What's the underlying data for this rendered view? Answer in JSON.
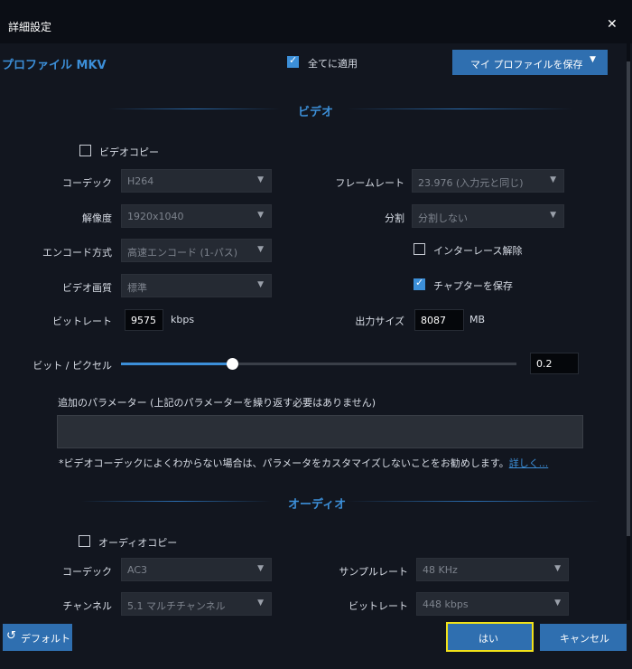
{
  "window": {
    "title": "詳細設定",
    "close_icon": "✕"
  },
  "profile": {
    "name": "プロファイル MKV"
  },
  "apply_all": {
    "label": "全てに適用",
    "checked": true
  },
  "save_profile": {
    "label": "マイ プロファイルを保存"
  },
  "video": {
    "section_title": "ビデオ",
    "copy": {
      "label": "ビデオコピー",
      "checked": false
    },
    "codec": {
      "label": "コーデック",
      "value": "H264"
    },
    "resolution": {
      "label": "解像度",
      "value": "1920x1040"
    },
    "encode_mode": {
      "label": "エンコード方式",
      "value": "高速エンコード (1-パス)"
    },
    "quality": {
      "label": "ビデオ画質",
      "value": "標準"
    },
    "bitrate": {
      "label": "ビットレート",
      "value": "9575",
      "unit": "kbps"
    },
    "framerate": {
      "label": "フレームレート",
      "value": "23.976 (入力元と同じ)"
    },
    "split": {
      "label": "分割",
      "value": "分割しない"
    },
    "deinterlace": {
      "label": "インターレース解除",
      "checked": false
    },
    "keep_chapters": {
      "label": "チャプターを保存",
      "checked": true
    },
    "output_size": {
      "label": "出力サイズ",
      "value": "8087",
      "unit": "MB"
    },
    "bits_per_pixel": {
      "label": "ビット / ピクセル",
      "value": "0.2",
      "slider_fraction": 0.28
    },
    "extra_params": {
      "label": "追加のパラメーター (上記のパラメーターを繰り返す必要はありません)",
      "value": ""
    },
    "note": {
      "text": "*ビデオコーデックによくわからない場合は、パラメータをカスタマイズしないことをお勧めします。",
      "link": "詳しく..."
    }
  },
  "audio": {
    "section_title": "オーディオ",
    "copy": {
      "label": "オーディオコピー",
      "checked": false
    },
    "codec": {
      "label": "コーデック",
      "value": "AC3"
    },
    "channels": {
      "label": "チャンネル",
      "value": "5.1 マルチチャンネル"
    },
    "sample_rate": {
      "label": "サンプルレート",
      "value": "48 KHz"
    },
    "bitrate": {
      "label": "ビットレート",
      "value": "448 kbps"
    }
  },
  "footer": {
    "default_label": "デフォルト",
    "ok_label": "はい",
    "cancel_label": "キャンセル"
  },
  "colors": {
    "accent": "#3c8fd8",
    "button": "#2f6fb0",
    "focus": "#f2e21a"
  }
}
